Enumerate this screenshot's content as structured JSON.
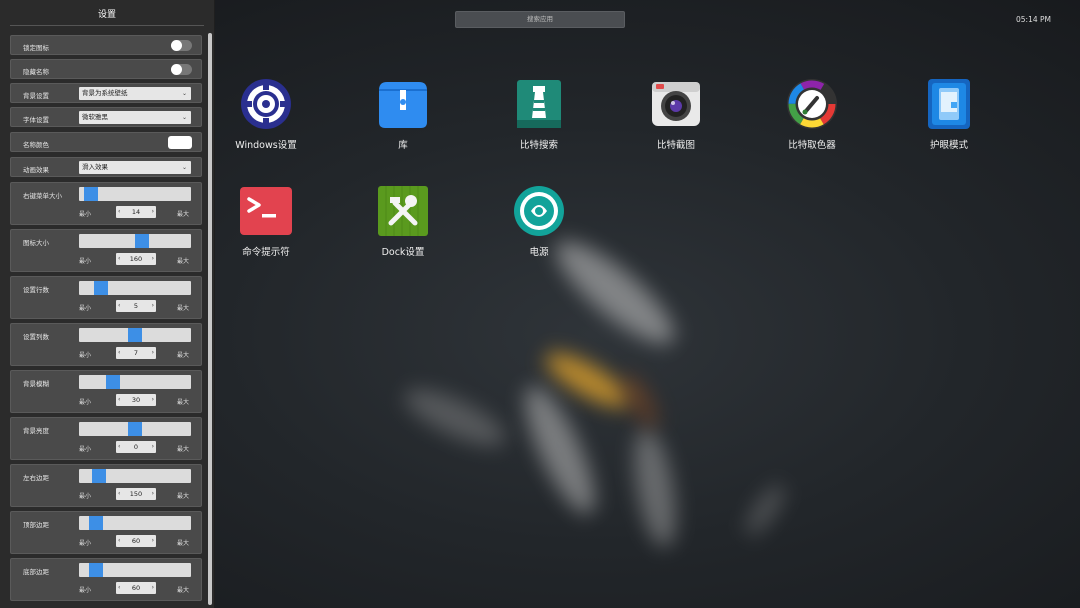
{
  "panel": {
    "title": "设置",
    "toggles": [
      {
        "label": "锁定图标",
        "on": false
      },
      {
        "label": "隐藏名称",
        "on": false
      }
    ],
    "selects": [
      {
        "label": "背景设置",
        "value": "背景为系统壁纸"
      },
      {
        "label": "字体设置",
        "value": "微软雅黑"
      }
    ],
    "name_color": {
      "label": "名称颜色",
      "color": "#ffffff"
    },
    "animation": {
      "label": "动画效果",
      "value": "滑入效果"
    },
    "sliders": [
      {
        "label": "右键菜单大小",
        "value": "14",
        "min_label": "最小",
        "max_label": "最大",
        "level": 0.05
      },
      {
        "label": "图标大小",
        "value": "160",
        "min_label": "最小",
        "max_label": "最大",
        "level": 0.57
      },
      {
        "label": "设置行数",
        "value": "5",
        "min_label": "最小",
        "max_label": "最大",
        "level": 0.15
      },
      {
        "label": "设置列数",
        "value": "7",
        "min_label": "最小",
        "max_label": "最大",
        "level": 0.5
      },
      {
        "label": "背景模糊",
        "value": "30",
        "min_label": "最小",
        "max_label": "最大",
        "level": 0.28
      },
      {
        "label": "背景亮度",
        "value": "0",
        "min_label": "最小",
        "max_label": "最大",
        "level": 0.5
      },
      {
        "label": "左右边距",
        "value": "150",
        "min_label": "最小",
        "max_label": "最大",
        "level": 0.13
      },
      {
        "label": "顶部边距",
        "value": "60",
        "min_label": "最小",
        "max_label": "最大",
        "level": 0.1
      },
      {
        "label": "底部边距",
        "value": "60",
        "min_label": "最小",
        "max_label": "最大",
        "level": 0.1
      }
    ]
  },
  "search": {
    "placeholder": "搜索应用"
  },
  "clock": "05:14 PM",
  "apps": [
    {
      "name": "Windows设置",
      "icon": "gear-icon"
    },
    {
      "name": "库",
      "icon": "library-icon"
    },
    {
      "name": "比特搜索",
      "icon": "lighthouse-icon"
    },
    {
      "name": "比特截图",
      "icon": "camera-icon"
    },
    {
      "name": "比特取色器",
      "icon": "color-picker-icon"
    },
    {
      "name": "护眼模式",
      "icon": "eye-care-icon"
    },
    {
      "name": "命令提示符",
      "icon": "terminal-icon"
    },
    {
      "name": "Dock设置",
      "icon": "tools-icon"
    },
    {
      "name": "电源",
      "icon": "power-icon"
    }
  ],
  "colors": {
    "slider_thumb": "#3d8fe6",
    "panel_bg": "#2b2b2b"
  }
}
